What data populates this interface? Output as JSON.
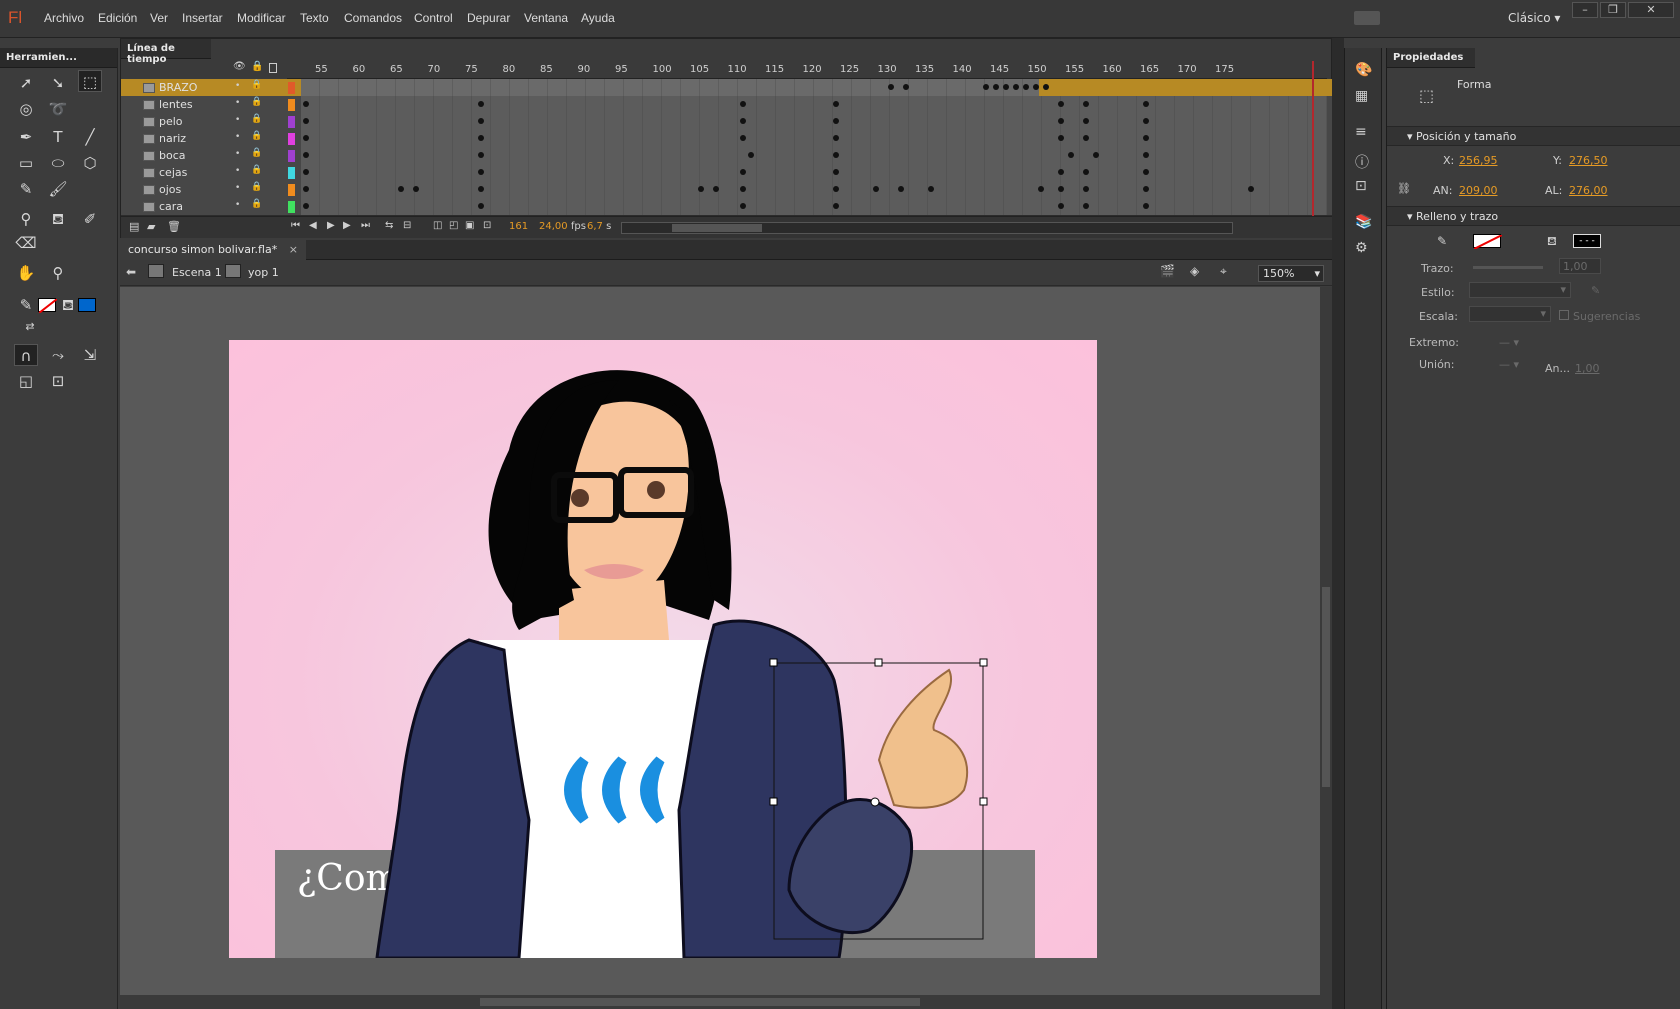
{
  "app": {
    "logo": "Fl",
    "workspace": "Clásico"
  },
  "menu": [
    "Archivo",
    "Edición",
    "Ver",
    "Insertar",
    "Modificar",
    "Texto",
    "Comandos",
    "Control",
    "Depurar",
    "Ventana",
    "Ayuda"
  ],
  "window_buttons": [
    "–",
    "❐",
    "✕"
  ],
  "tools_panel": {
    "title": "Herramien..."
  },
  "timeline": {
    "title": "Línea de tiempo",
    "ruler": [
      "55",
      "60",
      "65",
      "70",
      "75",
      "80",
      "85",
      "90",
      "95",
      "100",
      "105",
      "110",
      "115",
      "120",
      "125",
      "130",
      "135",
      "140",
      "145",
      "150",
      "155",
      "160",
      "165",
      "170",
      "175"
    ],
    "layers": [
      {
        "name": "BRAZO",
        "color": "#e05a2a",
        "selected": true
      },
      {
        "name": "lentes",
        "color": "#f08c1e"
      },
      {
        "name": "pelo",
        "color": "#a040d0"
      },
      {
        "name": "nariz",
        "color": "#e040e0"
      },
      {
        "name": "boca",
        "color": "#a040d0"
      },
      {
        "name": "cejas",
        "color": "#40d8e0"
      },
      {
        "name": "ojos",
        "color": "#f08c1e"
      },
      {
        "name": "cara",
        "color": "#40e060"
      }
    ],
    "current_frame": "161",
    "fps": "24,00",
    "fps_unit": "fps",
    "time": "6,7",
    "time_unit": "s"
  },
  "document": {
    "tab": "concurso simon bolivar.fla*",
    "close": "×"
  },
  "editbar": {
    "scene": "Escena 1",
    "symbol": "yop 1",
    "zoom": "150%"
  },
  "stage": {
    "caption": "¿Com"
  },
  "properties": {
    "title": "Propiedades",
    "type": "Forma",
    "position_section": "Posición y tamaño",
    "x_label": "X:",
    "x_value": "256,95",
    "y_label": "Y:",
    "y_value": "276,50",
    "w_label": "AN:",
    "w_value": "209,00",
    "h_label": "AL:",
    "h_value": "276,00",
    "fill_section": "Relleno y trazo",
    "stroke_label": "Trazo:",
    "stroke_value": "1,00",
    "style_label": "Estilo:",
    "scale_label": "Escala:",
    "hints_label": "Sugerencias",
    "cap_label": "Extremo:",
    "join_label": "Unión:",
    "miter_label": "An...",
    "miter_value": "1,00"
  }
}
